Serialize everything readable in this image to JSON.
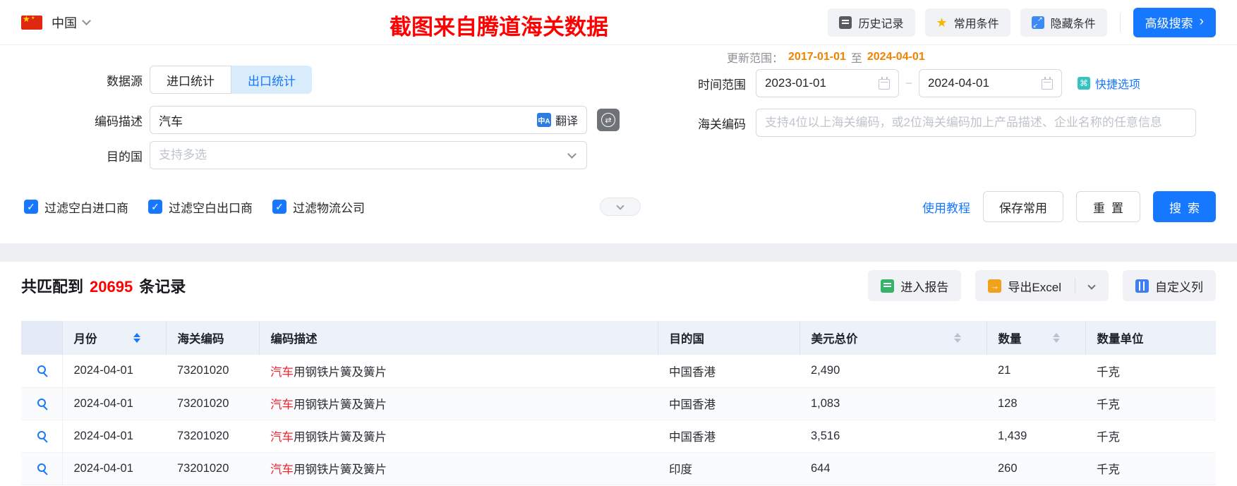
{
  "topbar": {
    "country": "中国",
    "watermark": "截图来自腾道海关数据",
    "buttons": {
      "history": "历史记录",
      "favorites": "常用条件",
      "hide": "隐藏条件",
      "advanced": "高级搜索"
    }
  },
  "icons": {
    "flag_star_big": "★",
    "flag_star_small": "★",
    "star": "★",
    "arrow_ne": "↗",
    "arrow_sw": "↙",
    "chevron_right": "›",
    "translate_glyph": "中A",
    "swap": "⇄",
    "command": "⌘",
    "check": "✓",
    "export_arrow": "→"
  },
  "form": {
    "data_source": {
      "label": "数据源",
      "tab_import": "进口统计",
      "tab_export": "出口统计"
    },
    "code_desc": {
      "label": "编码描述",
      "value": "汽车",
      "translate": "翻译"
    },
    "dest_country": {
      "label": "目的国",
      "placeholder": "支持多选"
    },
    "update_range": {
      "label": "更新范围：",
      "start": "2017-01-01",
      "to": "至",
      "end": "2024-04-01"
    },
    "time_range": {
      "label": "时间范围",
      "start": "2023-01-01",
      "dash": "–",
      "end": "2024-04-01"
    },
    "quick_options": {
      "label": "快捷选项"
    },
    "hs_code": {
      "label": "海关编码",
      "placeholder": "支持4位以上海关编码，或2位海关编码加上产品描述、企业名称的任意信息"
    },
    "filters": [
      {
        "label": "过滤空白进口商",
        "checked": true
      },
      {
        "label": "过滤空白出口商",
        "checked": true
      },
      {
        "label": "过滤物流公司",
        "checked": true
      }
    ],
    "actions": {
      "tutorial": "使用教程",
      "save": "保存常用",
      "reset": "重置",
      "search": "搜索"
    }
  },
  "results": {
    "summary": {
      "prefix": "共匹配到",
      "count": "20695",
      "suffix": "条记录"
    },
    "toolbar": {
      "report": "进入报告",
      "export": "导出Excel",
      "customize": "自定义列"
    },
    "table": {
      "columns": [
        "月份",
        "海关编码",
        "编码描述",
        "目的国",
        "美元总价",
        "数量",
        "数量单位"
      ],
      "rows": [
        {
          "month": "2024-04-01",
          "hs_code": "73201020",
          "desc_key": "汽车",
          "desc_rest": "用钢铁片簧及簧片",
          "dest": "中国香港",
          "usd_total": "2,490",
          "qty": "21",
          "unit": "千克"
        },
        {
          "month": "2024-04-01",
          "hs_code": "73201020",
          "desc_key": "汽车",
          "desc_rest": "用钢铁片簧及簧片",
          "dest": "中国香港",
          "usd_total": "1,083",
          "qty": "128",
          "unit": "千克"
        },
        {
          "month": "2024-04-01",
          "hs_code": "73201020",
          "desc_key": "汽车",
          "desc_rest": "用钢铁片簧及簧片",
          "dest": "中国香港",
          "usd_total": "3,516",
          "qty": "1,439",
          "unit": "千克"
        },
        {
          "month": "2024-04-01",
          "hs_code": "73201020",
          "desc_key": "汽车",
          "desc_rest": "用钢铁片簧及簧片",
          "dest": "印度",
          "usd_total": "644",
          "qty": "260",
          "unit": "千克"
        }
      ]
    }
  },
  "colors": {
    "primary": "#1677ff",
    "highlight_red": "#f5222d",
    "watermark_red": "#ff0000",
    "orange": "#f28200",
    "header_bg": "#edf1f9"
  }
}
